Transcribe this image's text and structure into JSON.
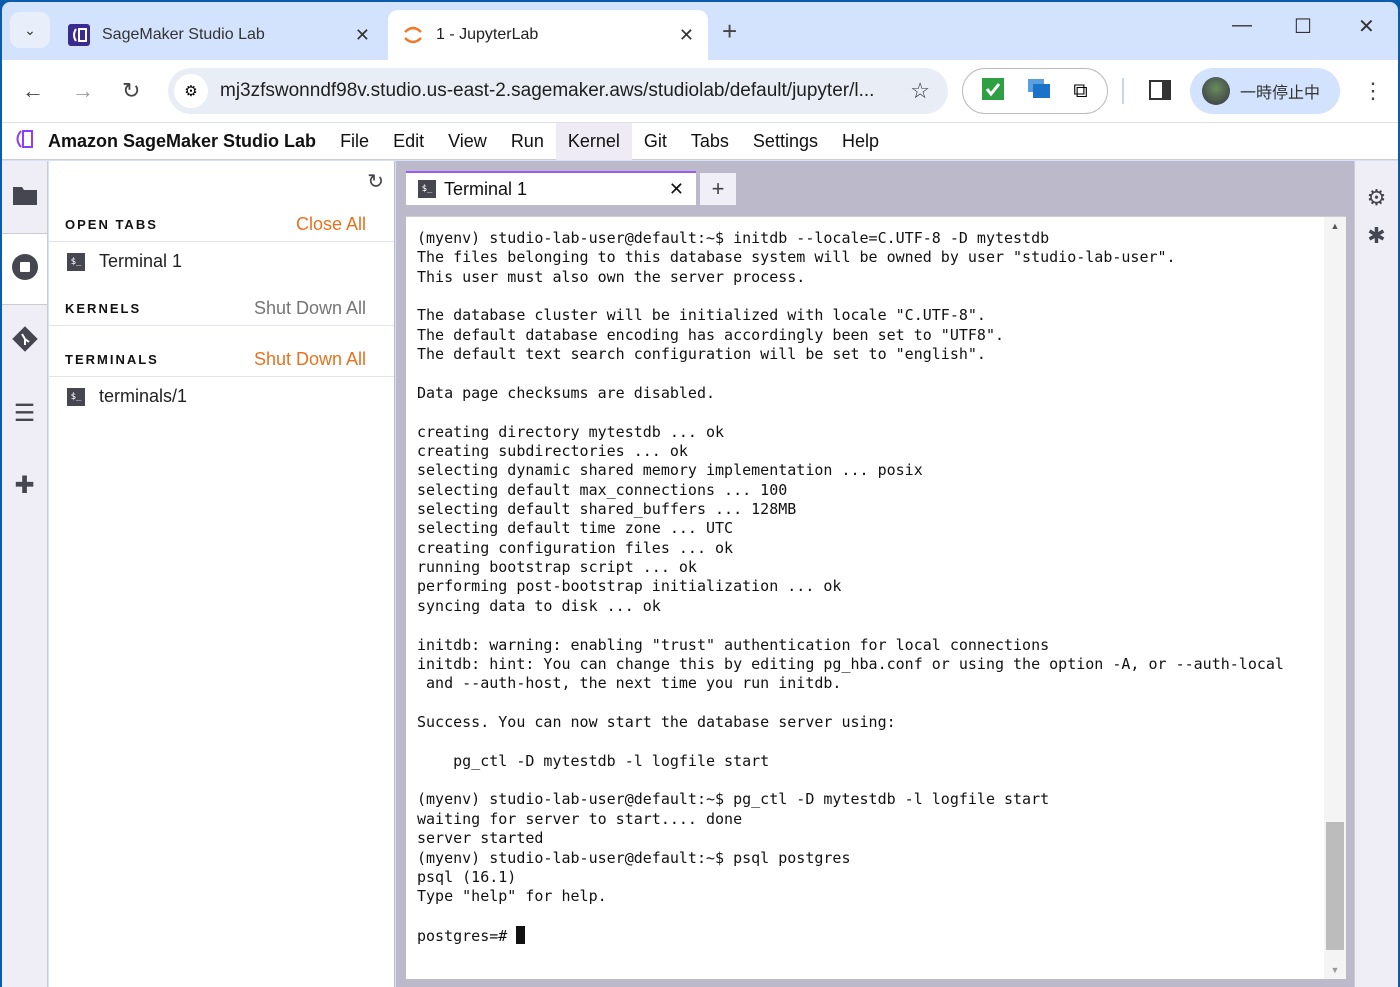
{
  "browser": {
    "tabs": [
      {
        "title": "SageMaker Studio Lab",
        "icon": "sagemaker-icon"
      },
      {
        "title": "1 - JupyterLab",
        "icon": "jupyter-icon",
        "active": true
      }
    ],
    "url": "mj3zfswonndf98v.studio.us-east-2.sagemaker.aws/studiolab/default/jupyter/l...",
    "profile_label": "一時停止中"
  },
  "app": {
    "brand": "Amazon SageMaker Studio Lab",
    "menu": [
      "File",
      "Edit",
      "View",
      "Run",
      "Kernel",
      "Git",
      "Tabs",
      "Settings",
      "Help"
    ],
    "active_menu": "Kernel",
    "accent": "#9b59f6"
  },
  "panel": {
    "open_tabs": {
      "heading": "OPEN TABS",
      "action": "Close All",
      "items": [
        "Terminal 1"
      ]
    },
    "kernels": {
      "heading": "KERNELS",
      "action": "Shut Down All"
    },
    "terminals": {
      "heading": "TERMINALS",
      "action": "Shut Down All",
      "items": [
        "terminals/1"
      ]
    },
    "action_color": "#e8711f",
    "disabled_color": "#757575"
  },
  "terminal": {
    "tab_label": "Terminal 1",
    "lines": [
      "(myenv) studio-lab-user@default:~$ initdb --locale=C.UTF-8 -D mytestdb",
      "The files belonging to this database system will be owned by user \"studio-lab-user\".",
      "This user must also own the server process.",
      "",
      "The database cluster will be initialized with locale \"C.UTF-8\".",
      "The default database encoding has accordingly been set to \"UTF8\".",
      "The default text search configuration will be set to \"english\".",
      "",
      "Data page checksums are disabled.",
      "",
      "creating directory mytestdb ... ok",
      "creating subdirectories ... ok",
      "selecting dynamic shared memory implementation ... posix",
      "selecting default max_connections ... 100",
      "selecting default shared_buffers ... 128MB",
      "selecting default time zone ... UTC",
      "creating configuration files ... ok",
      "running bootstrap script ... ok",
      "performing post-bootstrap initialization ... ok",
      "syncing data to disk ... ok",
      "",
      "initdb: warning: enabling \"trust\" authentication for local connections",
      "initdb: hint: You can change this by editing pg_hba.conf or using the option -A, or --auth-local",
      " and --auth-host, the next time you run initdb.",
      "",
      "Success. You can now start the database server using:",
      "",
      "    pg_ctl -D mytestdb -l logfile start",
      "",
      "(myenv) studio-lab-user@default:~$ pg_ctl -D mytestdb -l logfile start",
      "waiting for server to start.... done",
      "server started",
      "(myenv) studio-lab-user@default:~$ psql postgres",
      "psql (16.1)",
      "Type \"help\" for help.",
      ""
    ],
    "prompt": "postgres=# "
  }
}
